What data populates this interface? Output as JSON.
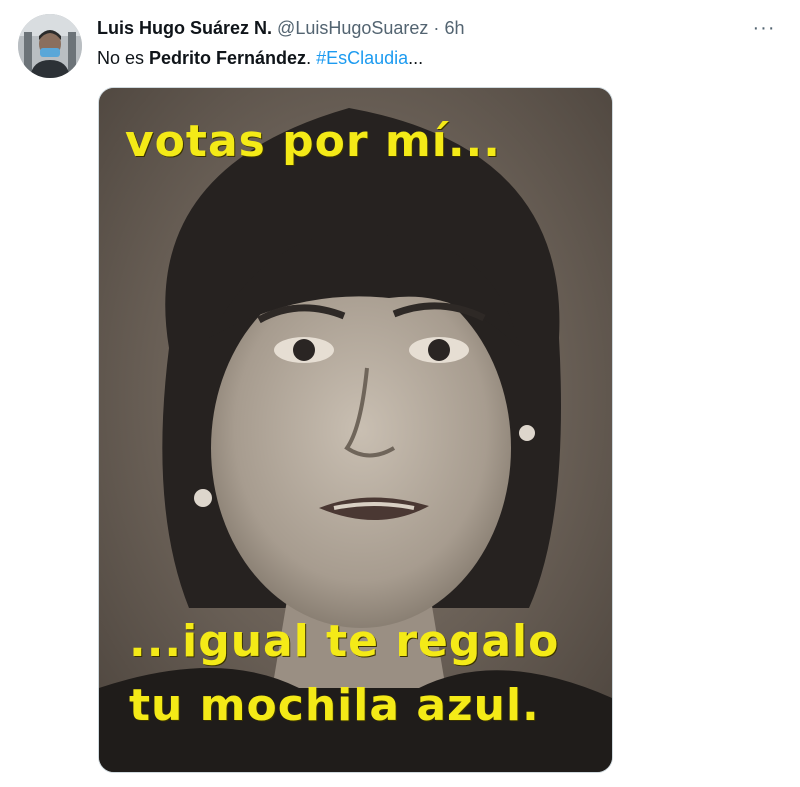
{
  "tweet": {
    "author_name": "Luis Hugo Suárez N.",
    "handle": "@LuisHugoSuarez",
    "separator": "·",
    "time": "6h",
    "more_label": "···",
    "text_prefix": "No es ",
    "text_bold": "Pedrito Fernández",
    "text_after_bold": ". ",
    "hashtag": "#EsClaudia",
    "text_ellipsis": "..."
  },
  "media": {
    "caption_top": "votas por mí...",
    "caption_bottom_line1": "...igual te regalo",
    "caption_bottom_line2": "tu mochila azul."
  },
  "colors": {
    "caption": "#f4ea17",
    "link": "#1d9bf0",
    "muted": "#536471"
  }
}
